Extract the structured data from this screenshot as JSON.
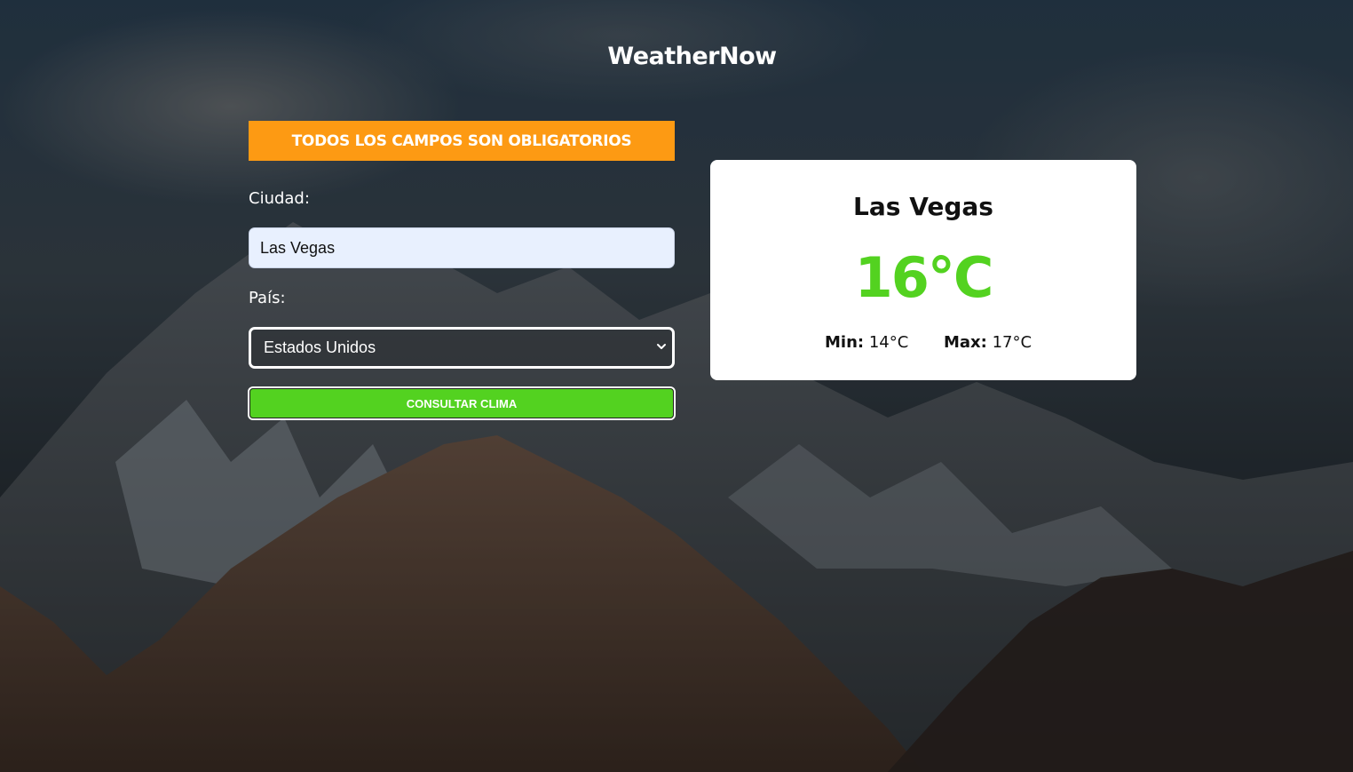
{
  "app": {
    "title": "WeatherNow"
  },
  "form": {
    "alert": "TODOS LOS CAMPOS SON OBLIGATORIOS",
    "city_label": "Ciudad:",
    "city_value": "Las Vegas",
    "country_label": "País:",
    "country_selected": "Estados Unidos",
    "submit_label": "CONSULTAR CLIMA"
  },
  "result": {
    "city": "Las Vegas",
    "temperature": "16°C",
    "min_label": "Min:",
    "min_value": "14°C",
    "max_label": "Max:",
    "max_value": "17°C"
  },
  "colors": {
    "alert": "#fd9a13",
    "accent_green": "#53d220",
    "card_bg": "#ffffff"
  },
  "icons": {
    "select_arrow": "chevron-down-icon"
  }
}
